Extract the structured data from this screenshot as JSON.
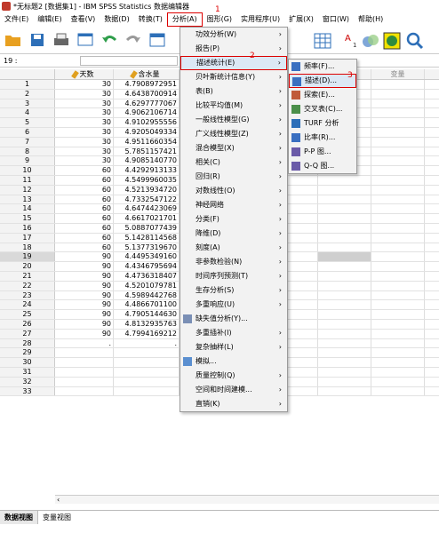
{
  "window": {
    "title": "*无标题2 [数据集1] - IBM SPSS Statistics 数据编辑器"
  },
  "menubar": [
    {
      "label": "文件(E)"
    },
    {
      "label": "编辑(E)"
    },
    {
      "label": "查看(V)"
    },
    {
      "label": "数据(D)"
    },
    {
      "label": "转换(T)"
    },
    {
      "label": "分析(A)"
    },
    {
      "label": "图形(G)"
    },
    {
      "label": "实用程序(U)"
    },
    {
      "label": "扩展(X)"
    },
    {
      "label": "窗口(W)"
    },
    {
      "label": "帮助(H)"
    }
  ],
  "refbar": {
    "cell_ref": "19 :"
  },
  "grid": {
    "columns": [
      "天数",
      "含水量",
      "变量",
      "变量"
    ],
    "extra_col_label": "变量",
    "rows": [
      {
        "n": "1",
        "days": "30",
        "water": "4.7908972951"
      },
      {
        "n": "2",
        "days": "30",
        "water": "4.6438700914"
      },
      {
        "n": "3",
        "days": "30",
        "water": "4.6297777067"
      },
      {
        "n": "4",
        "days": "30",
        "water": "4.9062106714"
      },
      {
        "n": "5",
        "days": "30",
        "water": "4.9102955556"
      },
      {
        "n": "6",
        "days": "30",
        "water": "4.9205049334"
      },
      {
        "n": "7",
        "days": "30",
        "water": "4.9511660354"
      },
      {
        "n": "8",
        "days": "30",
        "water": "5.7851157421"
      },
      {
        "n": "9",
        "days": "30",
        "water": "4.9085140770"
      },
      {
        "n": "10",
        "days": "60",
        "water": "4.4292913133"
      },
      {
        "n": "11",
        "days": "60",
        "water": "4.5499960035"
      },
      {
        "n": "12",
        "days": "60",
        "water": "4.5213934720"
      },
      {
        "n": "13",
        "days": "60",
        "water": "4.7332547122"
      },
      {
        "n": "14",
        "days": "60",
        "water": "4.6474423069"
      },
      {
        "n": "15",
        "days": "60",
        "water": "4.6617021701"
      },
      {
        "n": "16",
        "days": "60",
        "water": "5.0887077439"
      },
      {
        "n": "17",
        "days": "60",
        "water": "5.1428114568"
      },
      {
        "n": "18",
        "days": "60",
        "water": "5.1377319670"
      },
      {
        "n": "19",
        "days": "90",
        "water": "4.4495349160"
      },
      {
        "n": "20",
        "days": "90",
        "water": "4.4346795694"
      },
      {
        "n": "21",
        "days": "90",
        "water": "4.4736318407"
      },
      {
        "n": "22",
        "days": "90",
        "water": "4.5201079781"
      },
      {
        "n": "23",
        "days": "90",
        "water": "4.5989442768"
      },
      {
        "n": "24",
        "days": "90",
        "water": "4.4866701100"
      },
      {
        "n": "25",
        "days": "90",
        "water": "4.7905144630"
      },
      {
        "n": "26",
        "days": "90",
        "water": "4.8132935763"
      },
      {
        "n": "27",
        "days": "90",
        "water": "4.7994169212"
      },
      {
        "n": "28",
        "days": ".",
        "water": "."
      },
      {
        "n": "29",
        "days": "",
        "water": ""
      },
      {
        "n": "30",
        "days": "",
        "water": ""
      },
      {
        "n": "31",
        "days": "",
        "water": ""
      },
      {
        "n": "32",
        "days": "",
        "water": ""
      },
      {
        "n": "33",
        "days": "",
        "water": ""
      }
    ]
  },
  "analyze_menu": [
    {
      "label": "功效分析(W)",
      "arrow": "›"
    },
    {
      "label": "报告(P)",
      "arrow": "›"
    },
    {
      "label": "描述统计(E)",
      "arrow": "›"
    },
    {
      "label": "贝叶斯统计信息(Y)",
      "arrow": "›"
    },
    {
      "label": "表(B)",
      "arrow": "›"
    },
    {
      "label": "比较平均值(M)",
      "arrow": "›"
    },
    {
      "label": "一般线性模型(G)",
      "arrow": "›"
    },
    {
      "label": "广义线性模型(Z)",
      "arrow": "›"
    },
    {
      "label": "混合模型(X)",
      "arrow": "›"
    },
    {
      "label": "相关(C)",
      "arrow": "›"
    },
    {
      "label": "回归(R)",
      "arrow": "›"
    },
    {
      "label": "对数线性(O)",
      "arrow": "›"
    },
    {
      "label": "神经网络",
      "arrow": "›"
    },
    {
      "label": "分类(F)",
      "arrow": "›"
    },
    {
      "label": "降维(D)",
      "arrow": "›"
    },
    {
      "label": "刻度(A)",
      "arrow": "›"
    },
    {
      "label": "非参数检验(N)",
      "arrow": "›"
    },
    {
      "label": "时间序列预测(T)",
      "arrow": "›"
    },
    {
      "label": "生存分析(S)",
      "arrow": "›"
    },
    {
      "label": "多重响应(U)",
      "arrow": "›"
    },
    {
      "label": "缺失值分析(Y)...",
      "arrow": ""
    },
    {
      "label": "多重插补(I)",
      "arrow": "›"
    },
    {
      "label": "复杂抽样(L)",
      "arrow": "›"
    },
    {
      "label": "模拟...",
      "arrow": ""
    },
    {
      "label": "质量控制(Q)",
      "arrow": "›"
    },
    {
      "label": "空间和时间建模...",
      "arrow": "›"
    },
    {
      "label": "直销(K)",
      "arrow": "›"
    }
  ],
  "desc_menu": [
    {
      "label": "频率(F)..."
    },
    {
      "label": "描述(D)..."
    },
    {
      "label": "探索(E)..."
    },
    {
      "label": "交叉表(C)..."
    },
    {
      "label": "TURF 分析"
    },
    {
      "label": "比率(R)..."
    },
    {
      "label": "P-P 图..."
    },
    {
      "label": "Q-Q 图..."
    }
  ],
  "annotations": {
    "m1": "1",
    "m2": "2",
    "m3": "3"
  },
  "hscroll": {
    "left_arrow": "‹"
  },
  "view_tabs": [
    {
      "label": "数据视图"
    },
    {
      "label": "变量视图"
    }
  ]
}
